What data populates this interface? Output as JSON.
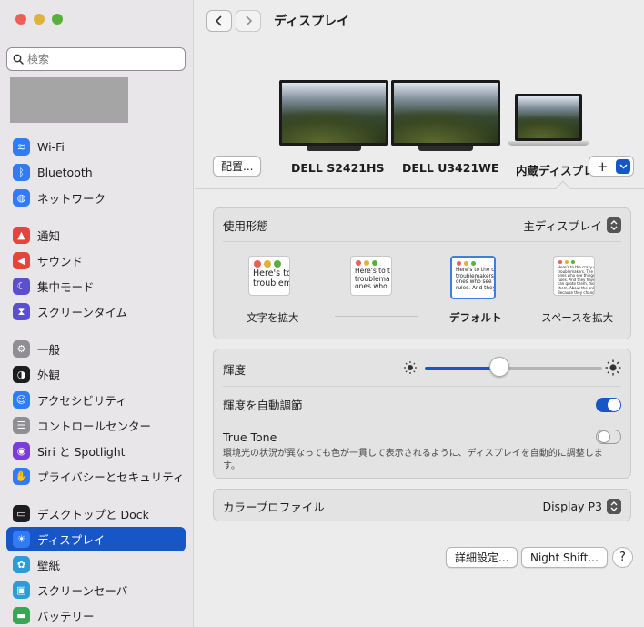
{
  "window": {
    "title": "ディスプレイ"
  },
  "search": {
    "placeholder": "検索"
  },
  "sidebar": {
    "items": [
      {
        "label": "Wi-Fi",
        "icon": "wifi-icon",
        "color": "#2f7cf6"
      },
      {
        "label": "Bluetooth",
        "icon": "bluetooth-icon",
        "color": "#2f7cf6"
      },
      {
        "label": "ネットワーク",
        "icon": "globe-icon",
        "color": "#2f7cf6"
      },
      {
        "label": "通知",
        "icon": "bell-icon",
        "color": "#e4453b"
      },
      {
        "label": "サウンド",
        "icon": "speaker-icon",
        "color": "#e4453b"
      },
      {
        "label": "集中モード",
        "icon": "moon-icon",
        "color": "#5b4fd0"
      },
      {
        "label": "スクリーンタイム",
        "icon": "hourglass-icon",
        "color": "#5b4fd0"
      },
      {
        "label": "一般",
        "icon": "gear-icon",
        "color": "#8e8e93"
      },
      {
        "label": "外観",
        "icon": "appearance-icon",
        "color": "#1d1d1f"
      },
      {
        "label": "アクセシビリティ",
        "icon": "accessibility-icon",
        "color": "#2f7cf6"
      },
      {
        "label": "コントロールセンター",
        "icon": "control-center-icon",
        "color": "#8e8e93"
      },
      {
        "label": "Siri と Spotlight",
        "icon": "siri-icon",
        "color": "#7a3dd8"
      },
      {
        "label": "プライバシーとセキュリティ",
        "icon": "hand-icon",
        "color": "#2f7cf6"
      },
      {
        "label": "デスクトップと Dock",
        "icon": "dock-icon",
        "color": "#1d1d1f"
      },
      {
        "label": "ディスプレイ",
        "icon": "sun-icon",
        "color": "#2f7cf6",
        "active": true
      },
      {
        "label": "壁紙",
        "icon": "flower-icon",
        "color": "#2b9cd8"
      },
      {
        "label": "スクリーンセーバ",
        "icon": "screensaver-icon",
        "color": "#2b9cd8"
      },
      {
        "label": "バッテリー",
        "icon": "battery-icon",
        "color": "#34a853"
      }
    ]
  },
  "displays": {
    "arrange_label": "配置...",
    "monitors": [
      {
        "name": "DELL S2421HS"
      },
      {
        "name": "DELL U3421WE"
      },
      {
        "name": "内蔵ディスプレ"
      }
    ],
    "add_label": "+"
  },
  "usage": {
    "label": "使用形態",
    "value": "主ディスプレイ",
    "options": [
      {
        "label": "文字を拡大",
        "sample": [
          "Here's to",
          "troublem"
        ]
      },
      {
        "label": "",
        "sample": [
          "Here's to t",
          "troublema",
          "ones who"
        ]
      },
      {
        "label": "デフォルト",
        "sample": [
          "Here's to the cr",
          "troublemakers.",
          "ones who see t",
          "rules. And they"
        ],
        "selected": true
      },
      {
        "label": "スペースを拡大",
        "sample": [
          "Here's to the crazy ones",
          "troublemakers. The round",
          "ones who see things diff",
          "rules. And they have no r",
          "can quote them, disagree",
          "them. About the only thi",
          "Because they change th"
        ]
      }
    ]
  },
  "brightness": {
    "label": "輝度",
    "value": 0.42
  },
  "auto_brightness": {
    "label": "輝度を自動調節",
    "on": true
  },
  "true_tone": {
    "label": "True Tone",
    "on": false,
    "description": "環境光の状況が異なっても色が一貫して表示されるように、ディスプレイを自動的に調整します。"
  },
  "color_profile": {
    "label": "カラープロファイル",
    "value": "Display P3"
  },
  "buttons": {
    "advanced": "詳細設定...",
    "night_shift": "Night Shift...",
    "help": "?"
  },
  "colors": {
    "accent": "#1756c6",
    "sidebar_bg": "#e8e6e9"
  }
}
